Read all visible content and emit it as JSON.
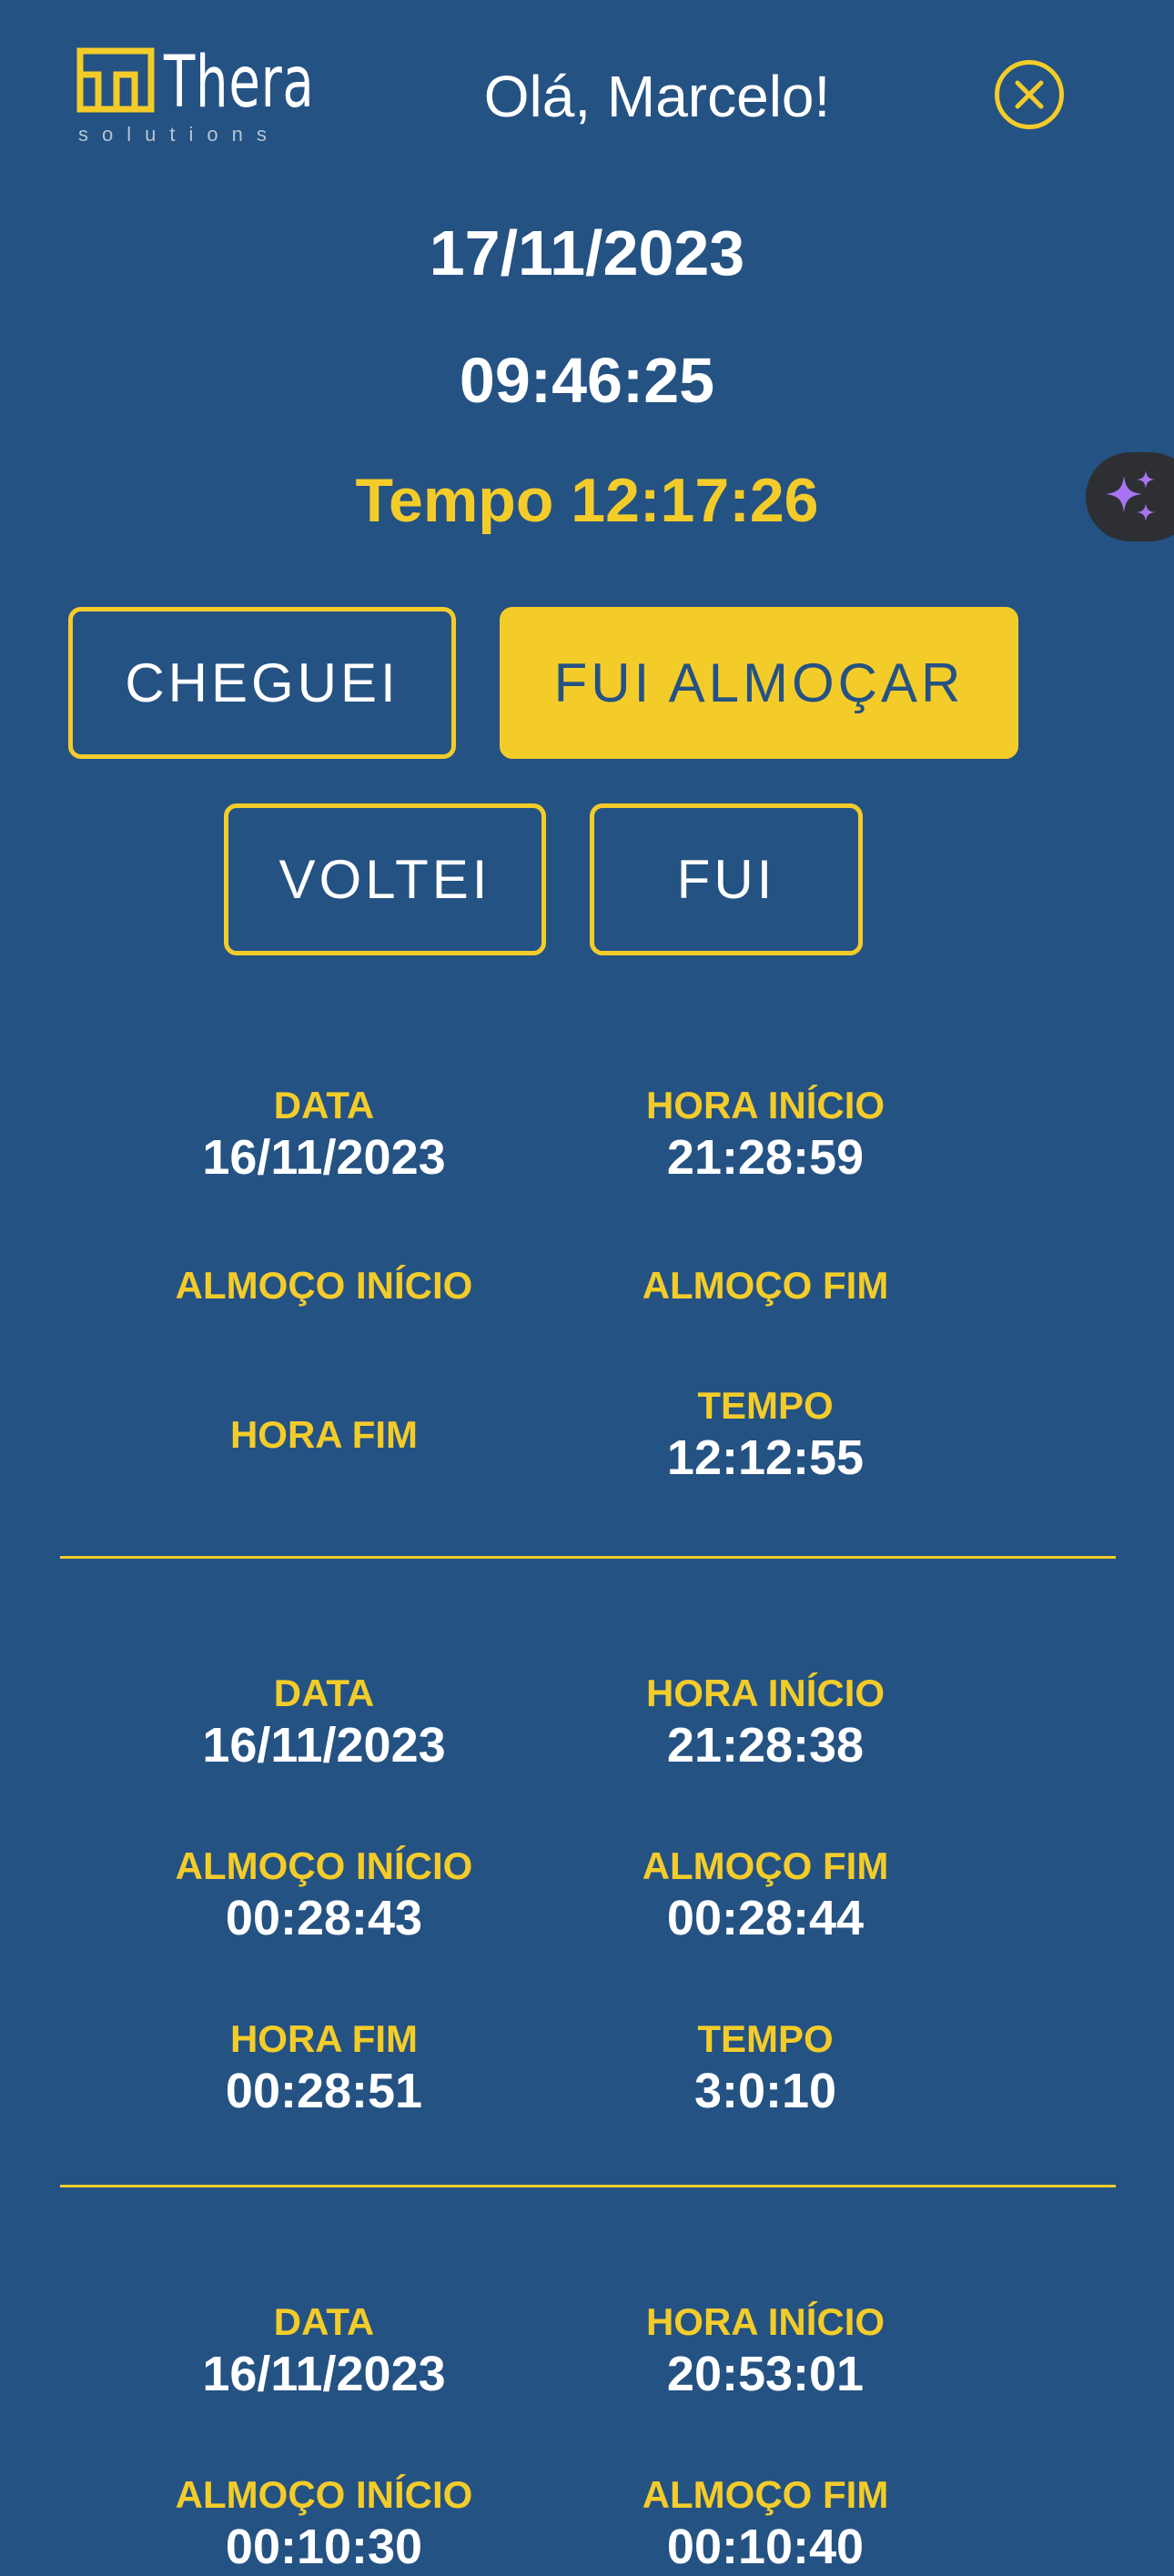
{
  "header": {
    "brand": "Thera",
    "brand_sub": "solutions",
    "greeting": "Olá, Marcelo!",
    "close_icon": "close-circle-icon"
  },
  "clock": {
    "date": "17/11/2023",
    "time": "09:46:25",
    "tempo": "Tempo 12:17:26"
  },
  "actions": {
    "cheguei": "CHEGUEI",
    "fui_almocar": "FUI ALMOÇAR",
    "voltei": "VOLTEI",
    "fui": "FUI"
  },
  "fab": {
    "icon": "sparkles-icon"
  },
  "labels": {
    "data": "DATA",
    "hora_inicio": "HORA INÍCIO",
    "almoco_inicio": "ALMOÇO INÍCIO",
    "almoco_fim": "ALMOÇO FIM",
    "hora_fim": "HORA FIM",
    "tempo": "TEMPO"
  },
  "records": [
    {
      "data": "16/11/2023",
      "hora_inicio": "21:28:59",
      "almoco_inicio": "",
      "almoco_fim": "",
      "hora_fim": "",
      "tempo": "12:12:55"
    },
    {
      "data": "16/11/2023",
      "hora_inicio": "21:28:38",
      "almoco_inicio": "00:28:43",
      "almoco_fim": "00:28:44",
      "hora_fim": "00:28:51",
      "tempo": "3:0:10"
    },
    {
      "data": "16/11/2023",
      "hora_inicio": "20:53:01",
      "almoco_inicio": "00:10:30",
      "almoco_fim": "00:10:40"
    }
  ],
  "colors": {
    "background": "#245283",
    "accent": "#f4cc2a",
    "text": "#ffffff",
    "fab": "#2d2f33",
    "fab_icon": "#a874f2"
  }
}
